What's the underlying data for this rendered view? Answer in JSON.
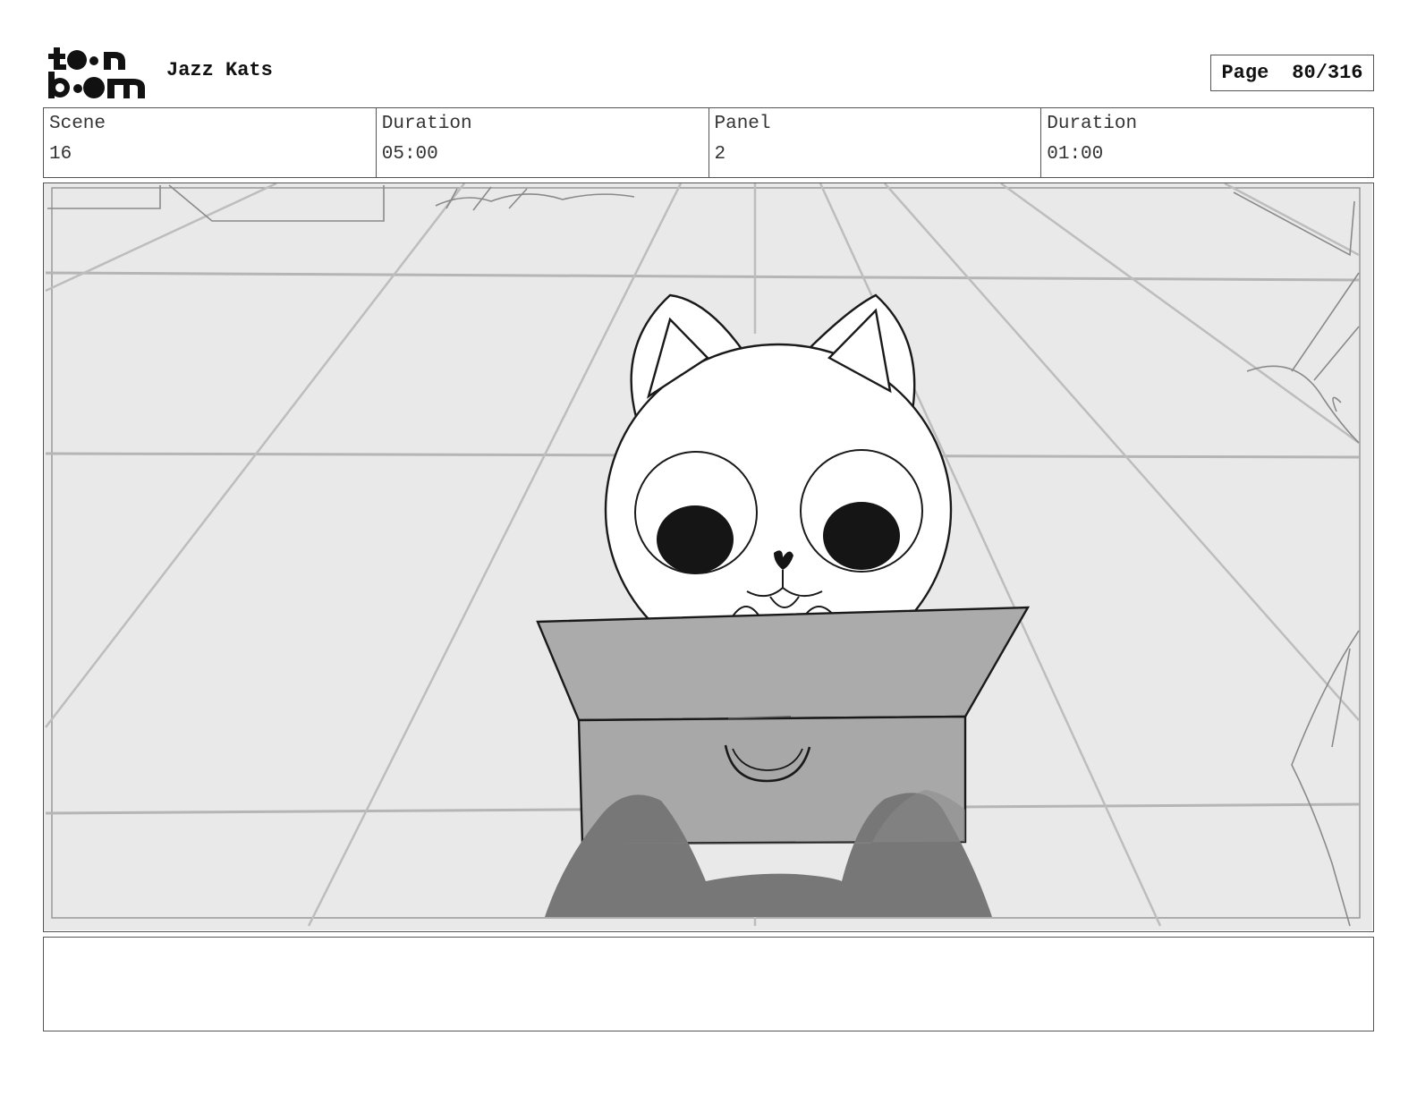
{
  "header": {
    "logo": {
      "icon": "toonboom-logo",
      "text_line1": "toon",
      "text_line2": "boom"
    },
    "project_title": "Jazz Kats",
    "page": {
      "label": "Page",
      "value": "80/316"
    }
  },
  "info": {
    "scene_label": "Scene",
    "scene_value": "16",
    "scene_duration_label": "Duration",
    "scene_duration_value": "05:00",
    "panel_label": "Panel",
    "panel_value": "2",
    "panel_duration_label": "Duration",
    "panel_duration_value": "01:00"
  },
  "panel": {
    "image_icon": "storyboard-sketch-cat-in-box",
    "colors": {
      "floor": "#e9e9e9",
      "grid": "#b8b8b8",
      "box": "#a9a9a9",
      "paws": "#777777",
      "ink": "#1a1a1a"
    }
  },
  "dialogue": {
    "text": ""
  }
}
